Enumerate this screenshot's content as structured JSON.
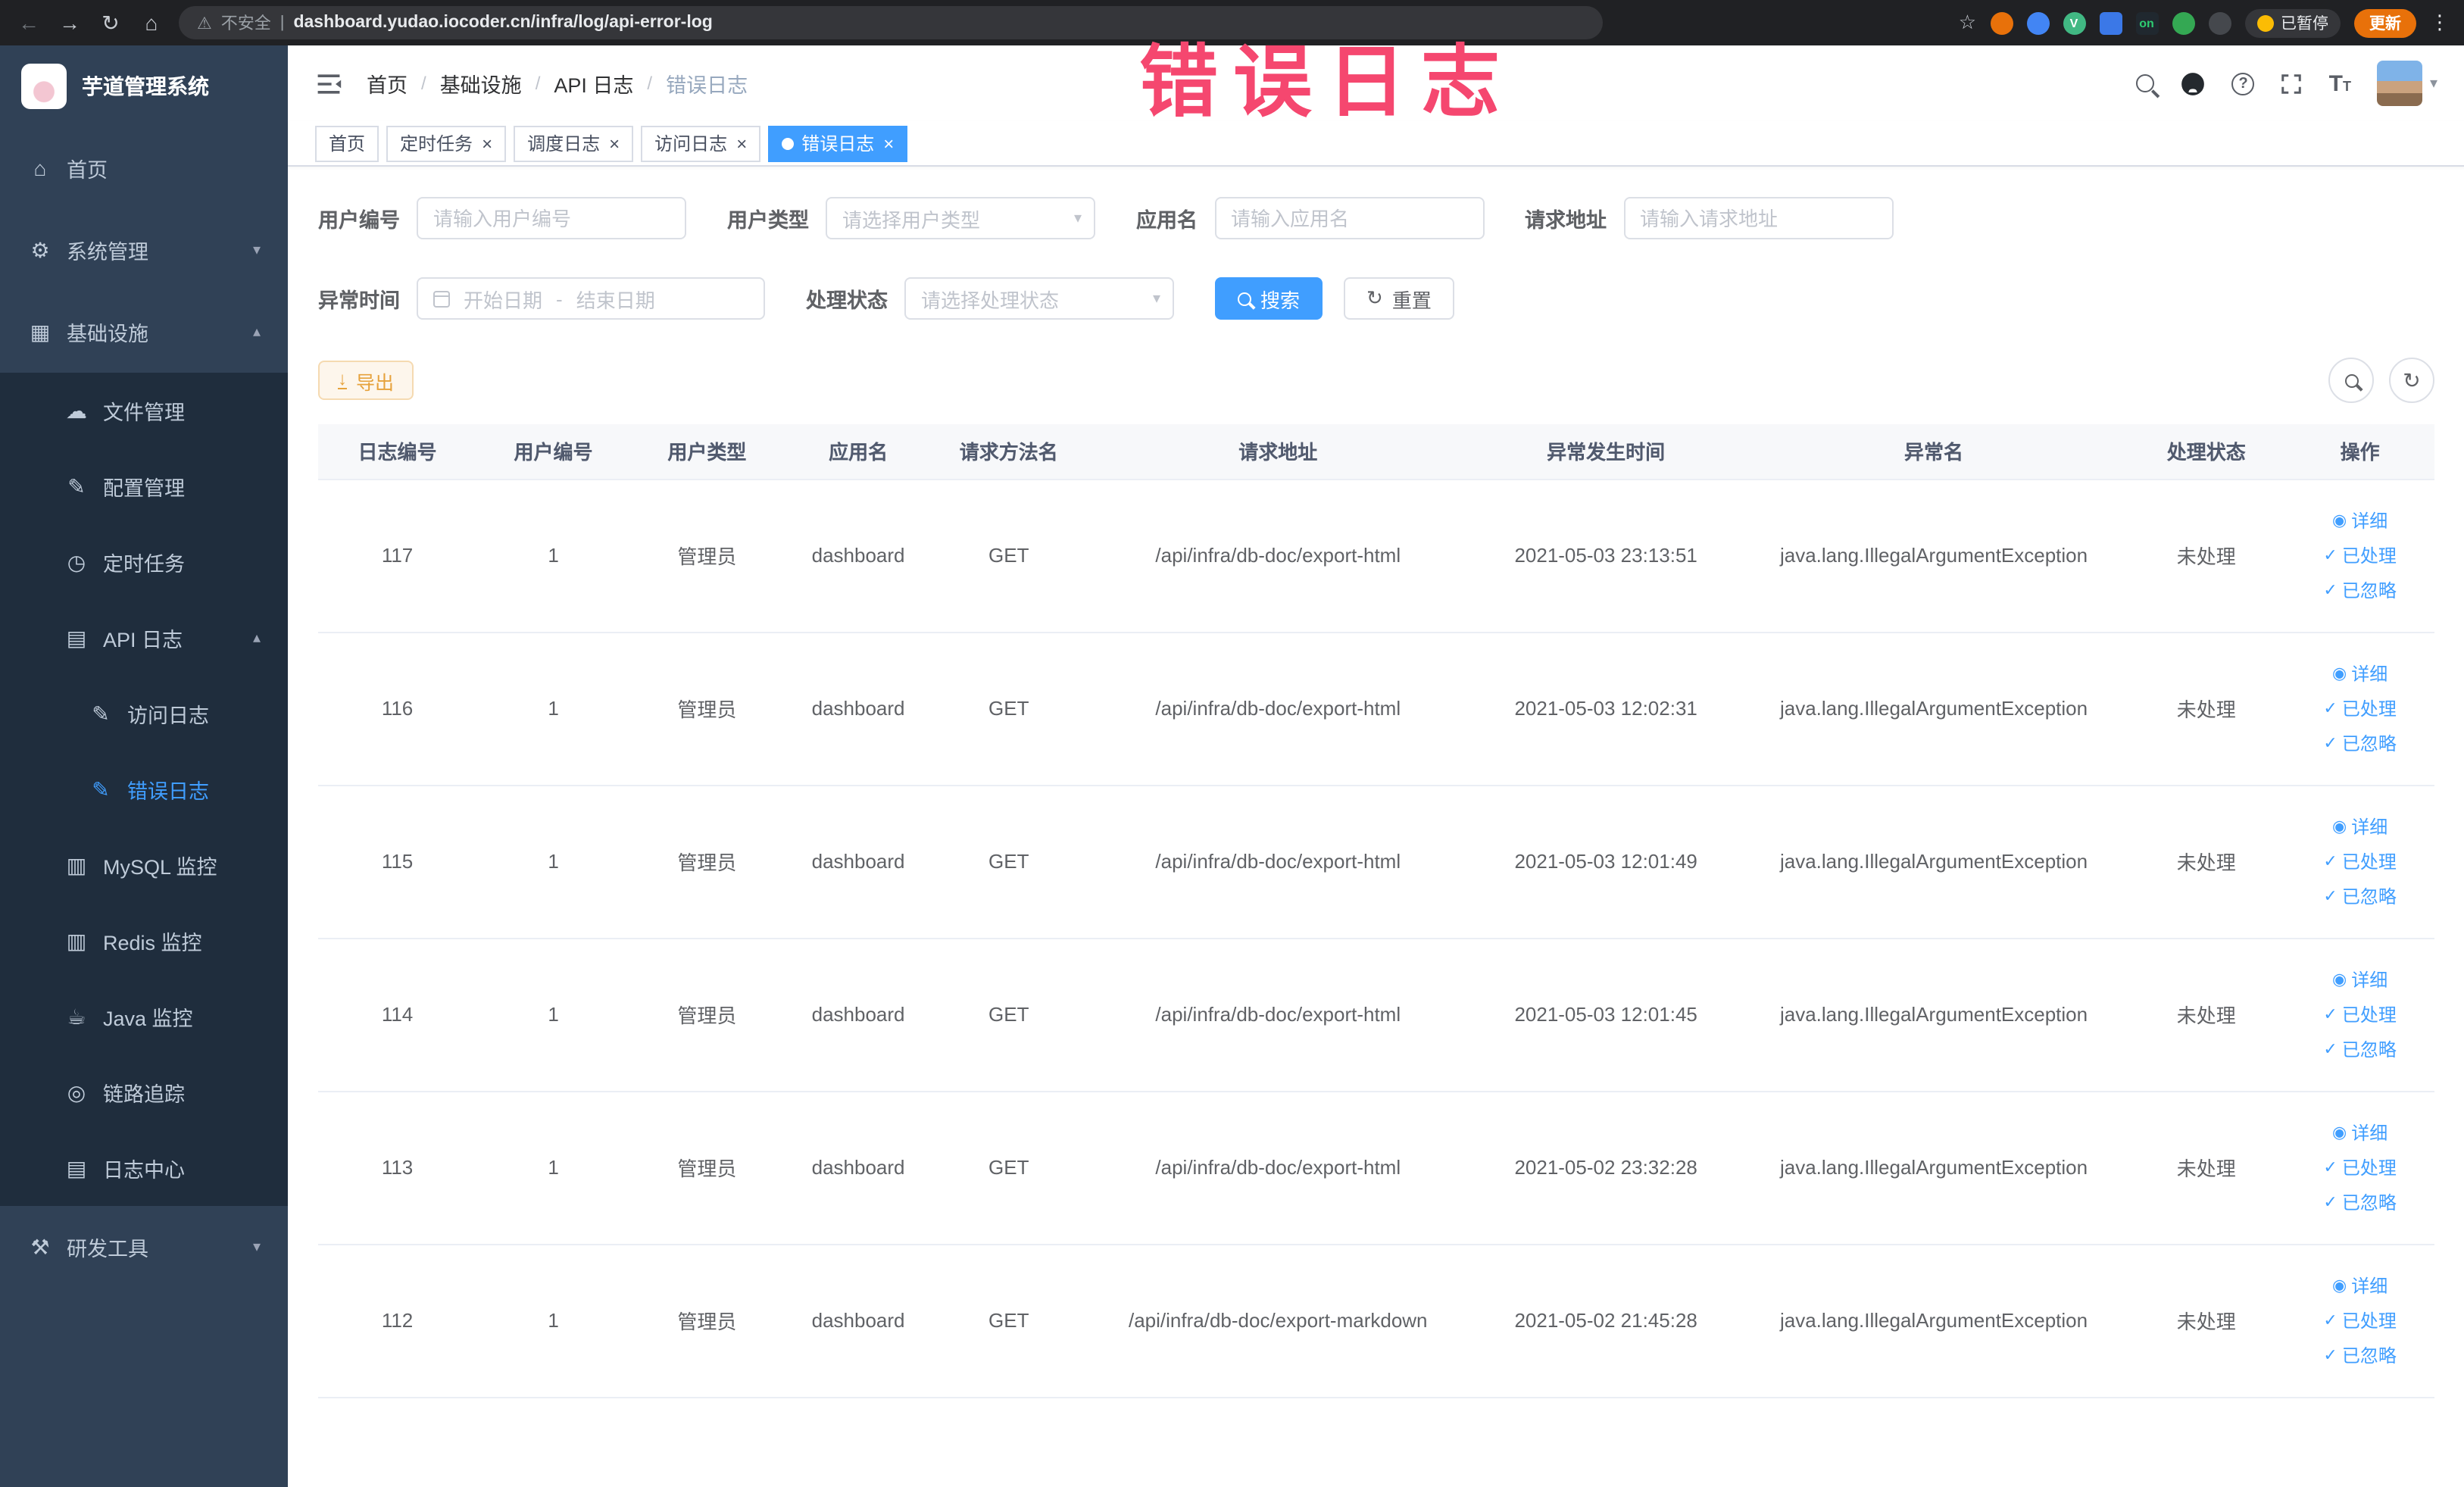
{
  "colors": {
    "accent": "#409EFF",
    "sidebar_bg": "#304156",
    "submenu_bg": "#1f2d3d",
    "annotation": "#f5476f",
    "warning_button": "#e6a23c",
    "chrome_bg": "#202124",
    "active_tab_bg": "#409EFF"
  },
  "annotation": {
    "text": "错误日志"
  },
  "browser": {
    "back_icon": "←",
    "forward_icon": "→",
    "reload_icon": "↻",
    "home_icon": "⌂",
    "warning_icon": "⚠",
    "security_label": "不安全",
    "divider": "|",
    "url": "dashboard.yudao.iocoder.cn/infra/log/api-error-log",
    "star_icon": "☆",
    "extensions": [
      {
        "name": "ext-orange-circle",
        "color": "#e8710a",
        "text": ""
      },
      {
        "name": "ext-blue-drop",
        "color": "#4285f4",
        "text": ""
      },
      {
        "name": "ext-vue-devtools",
        "color": "#41b883",
        "text": "V"
      },
      {
        "name": "ext-blue-grid",
        "color": "#3b78e7",
        "text": ""
      },
      {
        "name": "ext-on-badge",
        "color": "#20282f",
        "text": "on"
      },
      {
        "name": "ext-green-plant",
        "color": "#34a853",
        "text": ""
      },
      {
        "name": "ext-dark-pin",
        "color": "#45484d",
        "text": ""
      }
    ],
    "paused_badge": "已暂停",
    "update_label": "更新",
    "menu_dots_icon": "⋮"
  },
  "sidebar": {
    "logo_title": "芋道管理系统",
    "items": [
      {
        "label": "首页",
        "glyph": "⌂",
        "level": 0,
        "arrow": ""
      },
      {
        "label": "系统管理",
        "glyph": "⚙",
        "level": 0,
        "arrow": "▾"
      },
      {
        "label": "基础设施",
        "glyph": "▦",
        "level": 0,
        "arrow": "▴"
      },
      {
        "label": "文件管理",
        "glyph": "☁",
        "level": 1,
        "arrow": ""
      },
      {
        "label": "配置管理",
        "glyph": "✎",
        "level": 1,
        "arrow": ""
      },
      {
        "label": "定时任务",
        "glyph": "◷",
        "level": 1,
        "arrow": ""
      },
      {
        "label": "API 日志",
        "glyph": "▤",
        "level": 1,
        "arrow": "▴"
      },
      {
        "label": "访问日志",
        "glyph": "✎",
        "level": 2,
        "arrow": ""
      },
      {
        "label": "错误日志",
        "glyph": "✎",
        "level": 2,
        "arrow": "",
        "active": true
      },
      {
        "label": "MySQL 监控",
        "glyph": "▥",
        "level": 1,
        "arrow": ""
      },
      {
        "label": "Redis 监控",
        "glyph": "▥",
        "level": 1,
        "arrow": ""
      },
      {
        "label": "Java 监控",
        "glyph": "☕",
        "level": 1,
        "arrow": ""
      },
      {
        "label": "链路追踪",
        "glyph": "◎",
        "level": 1,
        "arrow": ""
      },
      {
        "label": "日志中心",
        "glyph": "▤",
        "level": 1,
        "arrow": ""
      },
      {
        "label": "研发工具",
        "glyph": "⚒",
        "level": 0,
        "arrow": "▾"
      }
    ]
  },
  "navbar": {
    "breadcrumb": [
      {
        "label": "首页"
      },
      {
        "label": "基础设施"
      },
      {
        "label": "API 日志"
      },
      {
        "label": "错误日志"
      }
    ],
    "separator": "/",
    "help_icon": "?",
    "caret_icon": "▾",
    "fontsize_big": "T",
    "fontsize_small": "T"
  },
  "tabs": [
    {
      "label": "首页",
      "close": ""
    },
    {
      "label": "定时任务",
      "close": "×"
    },
    {
      "label": "调度日志",
      "close": "×"
    },
    {
      "label": "访问日志",
      "close": "×"
    },
    {
      "label": "错误日志",
      "close": "×",
      "active": true
    }
  ],
  "filters": {
    "user_id_label": "用户编号",
    "user_id_placeholder": "请输入用户编号",
    "user_type_label": "用户类型",
    "user_type_placeholder": "请选择用户类型",
    "app_name_label": "应用名",
    "app_name_placeholder": "请输入应用名",
    "request_url_label": "请求地址",
    "request_url_placeholder": "请输入请求地址",
    "exception_time_label": "异常时间",
    "date_start_placeholder": "开始日期",
    "date_separator": "-",
    "date_end_placeholder": "结束日期",
    "process_status_label": "处理状态",
    "process_status_placeholder": "请选择处理状态",
    "search_label": "搜索",
    "reset_label": "重置",
    "reset_icon": "↻",
    "caret_icon": "▾"
  },
  "toolbar": {
    "export_label": "导出",
    "export_icon": "↓",
    "refresh_icon": "↻"
  },
  "table": {
    "columns": [
      "日志编号",
      "用户编号",
      "用户类型",
      "应用名",
      "请求方法名",
      "请求地址",
      "异常发生时间",
      "异常名",
      "处理状态",
      "操作"
    ],
    "actions": [
      {
        "label": "详细",
        "glyph": "◉"
      },
      {
        "label": "已处理",
        "glyph": "✓"
      },
      {
        "label": "已忽略",
        "glyph": "✓"
      }
    ],
    "rows": [
      {
        "id": "117",
        "user_id": "1",
        "user_type": "管理员",
        "app_name": "dashboard",
        "method": "GET",
        "url": "/api/infra/db-doc/export-html",
        "time": "2021-05-03 23:13:51",
        "exception": "java.lang.IllegalArgumentException",
        "status": "未处理"
      },
      {
        "id": "116",
        "user_id": "1",
        "user_type": "管理员",
        "app_name": "dashboard",
        "method": "GET",
        "url": "/api/infra/db-doc/export-html",
        "time": "2021-05-03 12:02:31",
        "exception": "java.lang.IllegalArgumentException",
        "status": "未处理"
      },
      {
        "id": "115",
        "user_id": "1",
        "user_type": "管理员",
        "app_name": "dashboard",
        "method": "GET",
        "url": "/api/infra/db-doc/export-html",
        "time": "2021-05-03 12:01:49",
        "exception": "java.lang.IllegalArgumentException",
        "status": "未处理"
      },
      {
        "id": "114",
        "user_id": "1",
        "user_type": "管理员",
        "app_name": "dashboard",
        "method": "GET",
        "url": "/api/infra/db-doc/export-html",
        "time": "2021-05-03 12:01:45",
        "exception": "java.lang.IllegalArgumentException",
        "status": "未处理"
      },
      {
        "id": "113",
        "user_id": "1",
        "user_type": "管理员",
        "app_name": "dashboard",
        "method": "GET",
        "url": "/api/infra/db-doc/export-html",
        "time": "2021-05-02 23:32:28",
        "exception": "java.lang.IllegalArgumentException",
        "status": "未处理"
      },
      {
        "id": "112",
        "user_id": "1",
        "user_type": "管理员",
        "app_name": "dashboard",
        "method": "GET",
        "url": "/api/infra/db-doc/export-markdown",
        "time": "2021-05-02 21:45:28",
        "exception": "java.lang.IllegalArgumentException",
        "status": "未处理"
      }
    ]
  }
}
